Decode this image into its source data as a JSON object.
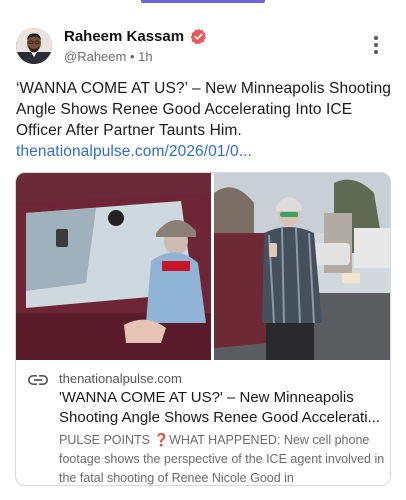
{
  "post": {
    "author": {
      "display_name": "Raheem Kassam",
      "handle": "@Raheem",
      "separator": "•",
      "age": "1h",
      "verified_icon": "verified-badge-icon",
      "verified_color": "#e8585c"
    },
    "text": "‘WANNA COME AT US?’ – New Minneapolis Shooting Angle Shows Renee Good Accelerating Into ICE Officer After Partner Taunts Him.",
    "link_text": "thenationalpulse.com/2026/01/0...",
    "link_color": "#2f6bd8"
  },
  "link_card": {
    "icon": "link-icon",
    "domain": "thenationalpulse.com",
    "title_line1": "'WANNA COME AT US?' – New Minneapolis",
    "title_line2": "Shooting Angle Shows Renee Good Accelerati...",
    "description_prefix": "PULSE POINTS",
    "description_icon": "❓",
    "description_rest": "WHAT HAPPENED: New cell phone footage shows the perspective of the ICE agent involved in the fatal shooting of Renee Nicole Good in"
  },
  "colors": {
    "accent": "#6f63d9",
    "question_mark": "#e0262b"
  }
}
